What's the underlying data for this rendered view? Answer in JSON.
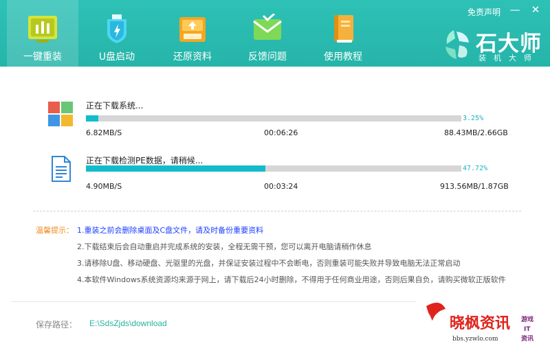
{
  "header": {
    "tabs": [
      {
        "label": "一键重装",
        "icon": "bar-chart-icon",
        "active": true
      },
      {
        "label": "U盘启动",
        "icon": "usb-shield-icon",
        "active": false
      },
      {
        "label": "还原资料",
        "icon": "restore-box-icon",
        "active": false
      },
      {
        "label": "反馈问题",
        "icon": "envelope-icon",
        "active": false
      },
      {
        "label": "使用教程",
        "icon": "book-icon",
        "active": false
      }
    ],
    "disclaimer": "免责声明",
    "minimize": "—",
    "close": "✕",
    "logo_text": "石大师",
    "logo_sub": "装机大师",
    "accent": "#2ec1b6"
  },
  "downloads": [
    {
      "title": "正在下载系统...",
      "percent_text": "3.25%",
      "progress": 0.0325,
      "speed": "6.82MB/S",
      "elapsed": "00:06:26",
      "size": "88.43MB/2.66GB",
      "icon": "windows-logo-icon"
    },
    {
      "title": "正在下载检测PE数据，请稍候...",
      "percent_text": "47.72%",
      "progress": 0.4772,
      "speed": "4.90MB/S",
      "elapsed": "00:03:24",
      "size": "913.56MB/1.87GB",
      "icon": "document-icon"
    }
  ],
  "tips": {
    "label": "温馨提示：",
    "items": [
      "1.重装之前会删除桌面及C盘文件，请及时备份重要资料",
      "2.下载结束后会自动重启并完成系统的安装，全程无需干预，您可以离开电脑请稍作休息",
      "3.请移除U盘、移动硬盘、光驱里的光盘，并保证安装过程中不会断电，否则重装可能失败并导致电脑无法正常启动",
      "4.本软件Windows系统资源均来源于网上，请下载后24小时删除，不得用于任何商业用途，否则后果自负，请购买微软正版软件"
    ]
  },
  "save_path": {
    "label": "保存路径：",
    "value": "E:\\SdsZjds\\download"
  },
  "watermark": {
    "title": "晓枫资讯",
    "url": "bbs.yzwlo.com",
    "side": "游戏IT资讯"
  }
}
